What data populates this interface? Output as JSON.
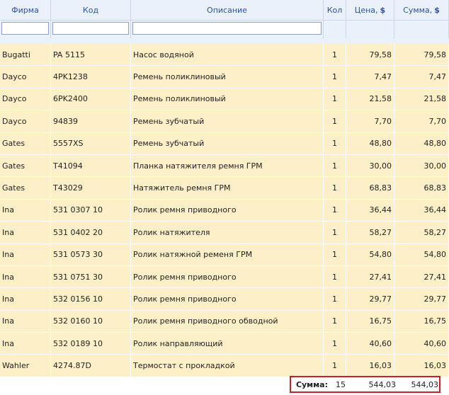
{
  "columns": {
    "firm": "Фирма",
    "code": "Код",
    "description": "Описание",
    "qty": "Кол",
    "price": "Цена,",
    "price_currency": "$",
    "sum": "Сумма,",
    "sum_currency": "$"
  },
  "filters": {
    "firm": "",
    "code": "",
    "description": ""
  },
  "rows": [
    {
      "firm": "Bugatti",
      "code": "PA 5115",
      "desc": "Насос водяной",
      "qty": "1",
      "price": "79,58",
      "sum": "79,58"
    },
    {
      "firm": "Dayco",
      "code": "4PK1238",
      "desc": "Ремень поликлиновый",
      "qty": "1",
      "price": "7,47",
      "sum": "7,47"
    },
    {
      "firm": "Dayco",
      "code": "6PK2400",
      "desc": "Ремень поликлиновый",
      "qty": "1",
      "price": "21,58",
      "sum": "21,58"
    },
    {
      "firm": "Dayco",
      "code": "94839",
      "desc": "Ремень зубчатый",
      "qty": "1",
      "price": "7,70",
      "sum": "7,70"
    },
    {
      "firm": "Gates",
      "code": "5557XS",
      "desc": "Ремень зубчатый",
      "qty": "1",
      "price": "48,80",
      "sum": "48,80"
    },
    {
      "firm": "Gates",
      "code": "T41094",
      "desc": "Планка натяжителя ремня ГРМ",
      "qty": "1",
      "price": "30,00",
      "sum": "30,00"
    },
    {
      "firm": "Gates",
      "code": "T43029",
      "desc": "Натяжитель ремня ГРМ",
      "qty": "1",
      "price": "68,83",
      "sum": "68,83"
    },
    {
      "firm": "Ina",
      "code": "531 0307 10",
      "desc": "Ролик ремня приводного",
      "qty": "1",
      "price": "36,44",
      "sum": "36,44"
    },
    {
      "firm": "Ina",
      "code": "531 0402 20",
      "desc": "Ролик натяжителя",
      "qty": "1",
      "price": "58,27",
      "sum": "58,27"
    },
    {
      "firm": "Ina",
      "code": "531 0573 30",
      "desc": "Ролик натяжной ременя ГРМ",
      "qty": "1",
      "price": "54,80",
      "sum": "54,80"
    },
    {
      "firm": "Ina",
      "code": "531 0751 30",
      "desc": "Ролик ремня приводного",
      "qty": "1",
      "price": "27,41",
      "sum": "27,41"
    },
    {
      "firm": "Ina",
      "code": "532 0156 10",
      "desc": "Ролик ремня приводного",
      "qty": "1",
      "price": "29,77",
      "sum": "29,77"
    },
    {
      "firm": "Ina",
      "code": "532 0160 10",
      "desc": "Ролик ремня приводного обводной",
      "qty": "1",
      "price": "16,75",
      "sum": "16,75"
    },
    {
      "firm": "Ina",
      "code": "532 0189 10",
      "desc": "Ролик направляющий",
      "qty": "1",
      "price": "40,60",
      "sum": "40,60"
    },
    {
      "firm": "Wahler",
      "code": "4274.87D",
      "desc": "Термостат с прокладкой",
      "qty": "1",
      "price": "16,03",
      "sum": "16,03"
    }
  ],
  "totals": {
    "label": "Сумма:",
    "qty": "15",
    "price": "544,03",
    "sum": "544,03"
  }
}
